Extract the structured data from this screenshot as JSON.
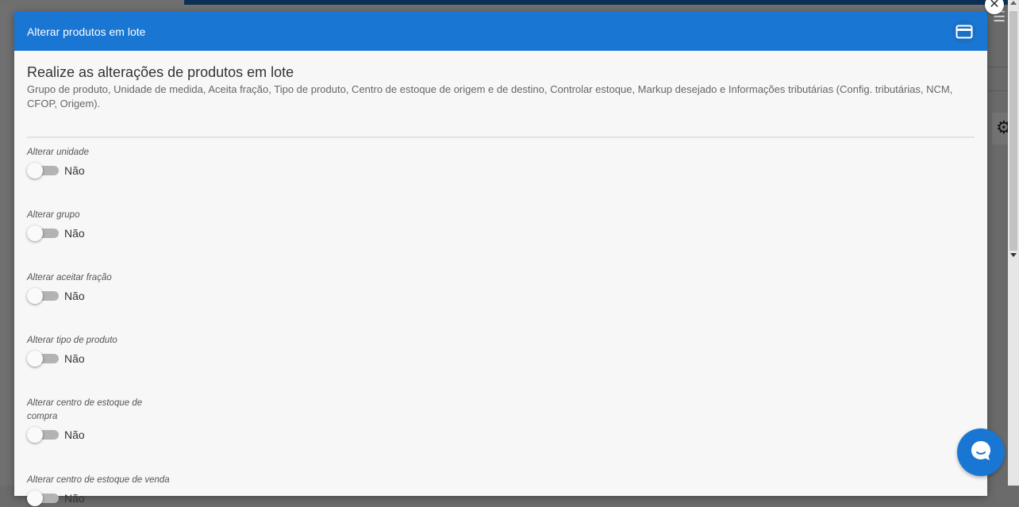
{
  "modal": {
    "title": "Alterar produtos em lote",
    "header_icon": "credit-card-icon",
    "close_icon": "close-icon",
    "close_glyph": "✕"
  },
  "intro": {
    "title": "Realize as alterações de produtos em lote",
    "description": "Grupo de produto, Unidade de medida, Aceita fração, Tipo de produto, Centro de estoque de origem e de destino, Controlar estoque, Markup desejado e Informações tributárias (Config. tributárias, NCM, CFOP, Origem)."
  },
  "fields": [
    {
      "label": "Alterar unidade",
      "state": "Não",
      "checked": false
    },
    {
      "label": "Alterar grupo",
      "state": "Não",
      "checked": false
    },
    {
      "label": "Alterar aceitar fração",
      "state": "Não",
      "checked": false
    },
    {
      "label": "Alterar tipo de produto",
      "state": "Não",
      "checked": false
    },
    {
      "label": "Alterar centro de estoque de compra",
      "state": "Não",
      "checked": false
    },
    {
      "label": "Alterar centro de estoque de venda",
      "state": "Não",
      "checked": false
    }
  ],
  "chat": {
    "icon": "chat-bubble-icon"
  },
  "background": {
    "gear_glyph": "⚙",
    "menu_glyph": "☰"
  },
  "colors": {
    "header": "#1976d2",
    "modal_bg": "#f7f7f7",
    "toggle_track": "#b3b3b3",
    "overlay": "#707070"
  }
}
